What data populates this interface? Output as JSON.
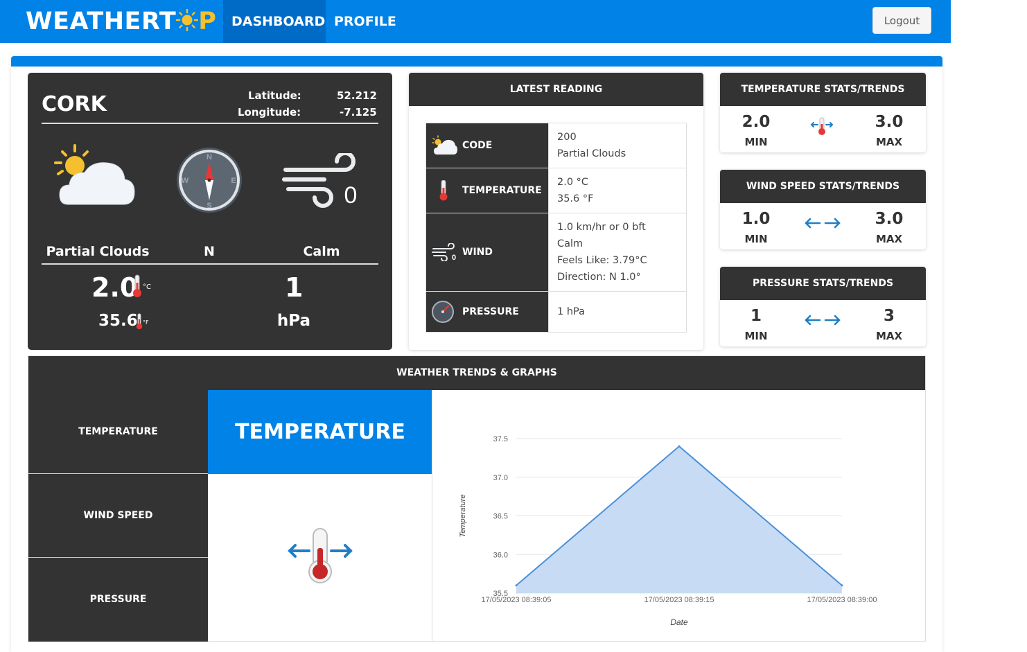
{
  "app": {
    "logo_prefix": "WEATHERT",
    "logo_suffix": "P",
    "nav": [
      {
        "label": "DASHBOARD",
        "active": true
      },
      {
        "label": "PROFILE",
        "active": false
      }
    ],
    "logout_label": "Logout",
    "accent_color": "#0082e6"
  },
  "station": {
    "name": "CORK",
    "latitude_label": "Latitude:",
    "latitude": "52.212",
    "longitude_label": "Longitude:",
    "longitude": "-7.125",
    "compass": {
      "n": "N",
      "e": "E",
      "s": "S",
      "w": "W"
    },
    "wind_icon_value": "0",
    "condition": "Partial Clouds",
    "wind_direction": "N",
    "wind_label": "Calm",
    "temp_c": "2.0",
    "temp_c_unit": "°C",
    "temp_f": "35.6",
    "temp_f_unit": "°F",
    "pressure": "1",
    "pressure_unit": "hPa"
  },
  "latest_reading": {
    "title": "LATEST READING",
    "rows": [
      {
        "label": "CODE",
        "icon": "partial-cloud-icon",
        "values": [
          "200",
          "Partial Clouds"
        ]
      },
      {
        "label": "TEMPERATURE",
        "icon": "thermometer-icon",
        "values": [
          "2.0 °C",
          "35.6 °F"
        ]
      },
      {
        "label": "WIND",
        "icon": "wind-icon",
        "values": [
          "1.0 km/hr or 0 bft",
          "Calm",
          "Feels Like: 3.79°C",
          "Direction: N 1.0°"
        ]
      },
      {
        "label": "PRESSURE",
        "icon": "barometer-icon",
        "values": [
          "1 hPa"
        ]
      }
    ]
  },
  "stats": [
    {
      "title": "TEMPERATURE STATS/TRENDS",
      "min": "2.0",
      "max": "3.0",
      "min_label": "MIN",
      "max_label": "MAX",
      "icon": "thermometer-trend-icon"
    },
    {
      "title": "WIND SPEED STATS/TRENDS",
      "min": "1.0",
      "max": "3.0",
      "min_label": "MIN",
      "max_label": "MAX",
      "icon": "steady-arrows-icon"
    },
    {
      "title": "PRESSURE STATS/TRENDS",
      "min": "1",
      "max": "3",
      "min_label": "MIN",
      "max_label": "MAX",
      "icon": "steady-arrows-icon"
    }
  ],
  "trends": {
    "title": "WEATHER TRENDS & GRAPHS",
    "tabs": [
      "TEMPERATURE",
      "WIND SPEED",
      "PRESSURE"
    ],
    "banner": "TEMPERATURE"
  },
  "chart_data": {
    "type": "area",
    "categories": [
      "17/05/2023 08:39:05",
      "17/05/2023 08:39:15",
      "17/05/2023 08:39:00"
    ],
    "series": [
      {
        "values": [
          35.6,
          37.4,
          35.6
        ]
      }
    ],
    "xlabel": "Date",
    "ylabel": "Temperature",
    "ylim": [
      35.5,
      37.5
    ],
    "yticks": [
      "35.5",
      "36.0",
      "36.5",
      "37.0",
      "37.5"
    ],
    "grid": true,
    "color": "#4a90d9",
    "fill": "#c7dcf4"
  }
}
